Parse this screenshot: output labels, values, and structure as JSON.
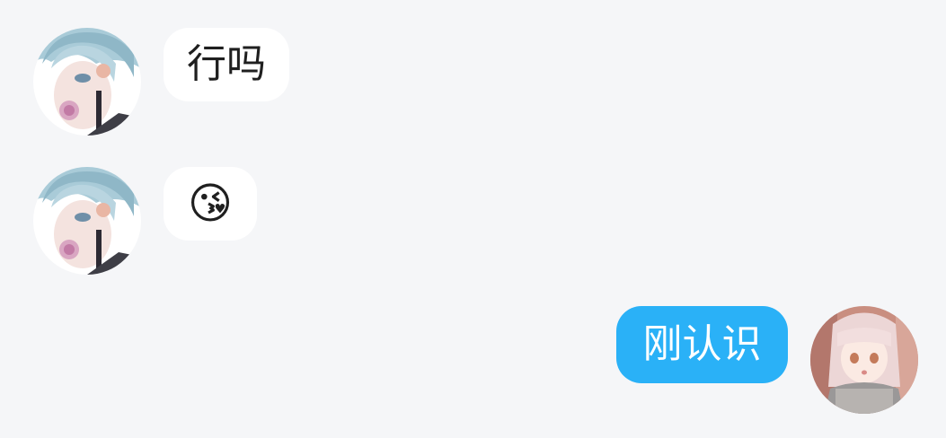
{
  "colors": {
    "background": "#f5f6f8",
    "incoming_bubble": "#ffffff",
    "outgoing_bubble": "#2ab1f7",
    "outgoing_text": "#ffffff",
    "incoming_text": "#1f1f1f"
  },
  "messages": [
    {
      "sender": "contact",
      "text": "行吗"
    },
    {
      "sender": "contact",
      "text": "😘"
    },
    {
      "sender": "self",
      "text": "刚认识"
    }
  ]
}
